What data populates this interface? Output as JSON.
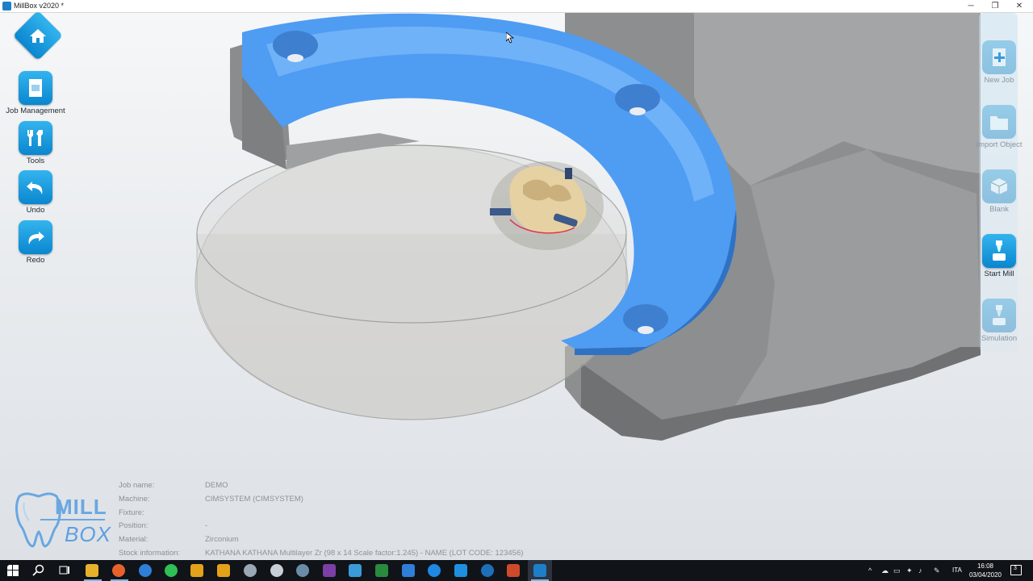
{
  "window": {
    "title": "MillBox v2020 *",
    "minimize": "─",
    "maximize": "❐",
    "close": "✕"
  },
  "left_toolbar": {
    "home_icon": "home-icon",
    "items": [
      {
        "label": "Job Management",
        "icon": "job-management-icon"
      },
      {
        "label": "Tools",
        "icon": "tools-icon"
      },
      {
        "label": "Undo",
        "icon": "undo-icon"
      },
      {
        "label": "Redo",
        "icon": "redo-icon"
      }
    ]
  },
  "right_toolbar": {
    "items": [
      {
        "label": "New Job",
        "icon": "new-job-icon",
        "state": "disabled"
      },
      {
        "label": "Import Object",
        "icon": "import-object-icon",
        "state": "disabled"
      },
      {
        "label": "Blank",
        "icon": "blank-icon",
        "state": "disabled"
      },
      {
        "label": "Start Mill",
        "icon": "start-mill-icon",
        "state": "enabled"
      },
      {
        "label": "Simulation",
        "icon": "simulation-icon",
        "state": "disabled"
      }
    ]
  },
  "job_info": {
    "rows": [
      {
        "key": "Job name:",
        "value": "DEMO"
      },
      {
        "key": "Machine:",
        "value": "CIMSYSTEM (CIMSYSTEM)"
      },
      {
        "key": "Fixture:",
        "value": ""
      },
      {
        "key": "Position:",
        "value": "-"
      },
      {
        "key": "Material:",
        "value": "Zirconium"
      },
      {
        "key": "Stock information:",
        "value": "KATHANA KATHANA Multilayer Zr (98 x 14 Scale factor:1.245) - NAME (LOT CODE: 123456)"
      }
    ]
  },
  "logo": {
    "line1": "MILL",
    "line2": "BOX"
  },
  "taskbar": {
    "time": "16:08",
    "date": "03/04/2020",
    "language": "ITA",
    "notification_count": "3"
  },
  "colors": {
    "accent": "#0a86cf",
    "fixture_blue": "#4f9cf3",
    "holder_gray": "#8d8f91"
  }
}
